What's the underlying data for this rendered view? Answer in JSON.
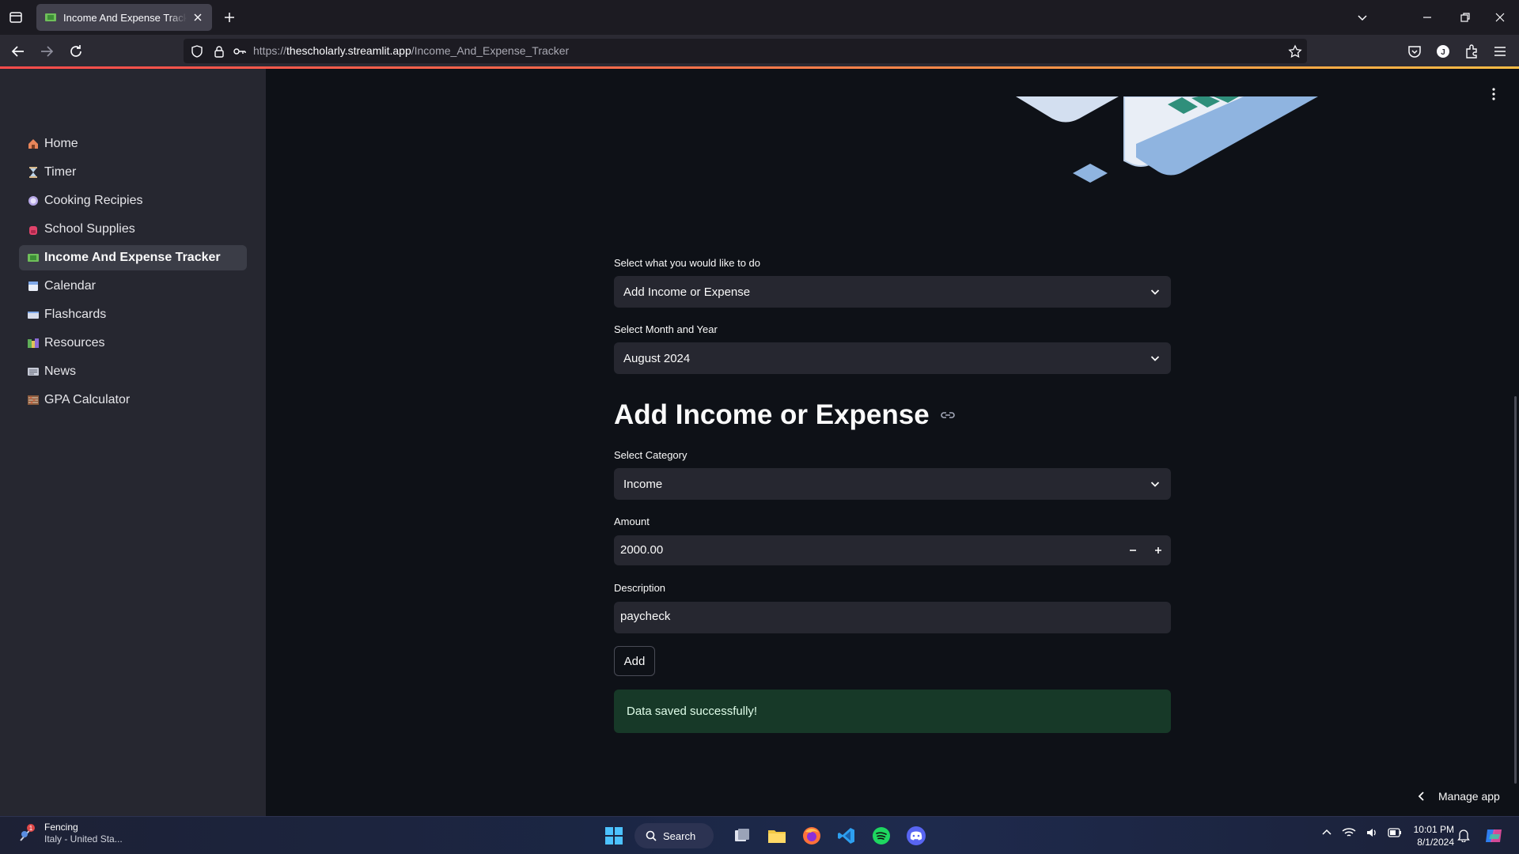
{
  "browser": {
    "tab_title": "Income And Expense Tracker by",
    "url_host": "thescholarly.streamlit.app",
    "url_prefix": "https://",
    "url_path": "/Income_And_Expense_Tracker"
  },
  "sidebar": {
    "items": [
      {
        "label": "Home",
        "icon": "house-icon",
        "color": "#e8855a"
      },
      {
        "label": "Timer",
        "icon": "hourglass-icon",
        "color": "#d9b98a"
      },
      {
        "label": "Cooking Recipies",
        "icon": "plate-icon",
        "color": "#b6a7e6"
      },
      {
        "label": "School Supplies",
        "icon": "backpack-icon",
        "color": "#e0436a"
      },
      {
        "label": "Income And Expense Tracker",
        "icon": "money-icon",
        "color": "#6fbf5a"
      },
      {
        "label": "Calendar",
        "icon": "calendar-icon",
        "color": "#7fa8e8"
      },
      {
        "label": "Flashcards",
        "icon": "flashcard-icon",
        "color": "#d7dcea"
      },
      {
        "label": "Resources",
        "icon": "books-icon",
        "color": "#5fae58"
      },
      {
        "label": "News",
        "icon": "newspaper-icon",
        "color": "#c6cad6"
      },
      {
        "label": "GPA Calculator",
        "icon": "abacus-icon",
        "color": "#d06b4a"
      }
    ],
    "active_index": 4
  },
  "form": {
    "action_label": "Select what you would like to do",
    "action_value": "Add Income or Expense",
    "month_label": "Select Month and Year",
    "month_value": "August 2024",
    "heading": "Add Income or Expense",
    "category_label": "Select Category",
    "category_value": "Income",
    "amount_label": "Amount",
    "amount_value": "2000.00",
    "description_label": "Description",
    "description_value": "paycheck",
    "add_button": "Add",
    "success_message": "Data saved successfully!"
  },
  "manage_app": "Manage app",
  "taskbar": {
    "weather_title": "Fencing",
    "weather_sub": "Italy - United Sta...",
    "weather_badge": "1",
    "search_label": "Search",
    "time": "10:01 PM",
    "date": "8/1/2024"
  },
  "colors": {
    "accent": "#ff4b4b",
    "success_bg": "#173928",
    "sidebar_bg": "#262730",
    "main_bg": "#0e1117"
  }
}
